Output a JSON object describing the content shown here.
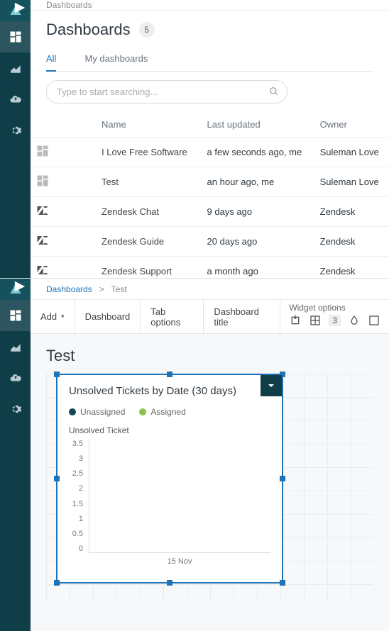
{
  "top": {
    "breadcrumb": "Dashboards",
    "title": "Dashboards",
    "count": "5",
    "tabs": {
      "all": "All",
      "mine": "My dashboards"
    },
    "search_placeholder": "Type to start searching...",
    "columns": {
      "name": "Name",
      "updated": "Last updated",
      "owner": "Owner"
    },
    "rows": [
      {
        "icon": "dash",
        "name": "I Love Free Software",
        "updated": "a few seconds ago, me",
        "owner": "Suleman Love"
      },
      {
        "icon": "dash",
        "name": "Test",
        "updated": "an hour ago, me",
        "owner": "Suleman Love"
      },
      {
        "icon": "zen",
        "name": "Zendesk Chat",
        "updated": "9 days ago",
        "owner": "Zendesk"
      },
      {
        "icon": "zen",
        "name": "Zendesk Guide",
        "updated": "20 days ago",
        "owner": "Zendesk"
      },
      {
        "icon": "zen",
        "name": "Zendesk Support",
        "updated": "a month ago",
        "owner": "Zendesk"
      }
    ]
  },
  "bottom": {
    "breadcrumb": {
      "root": "Dashboards",
      "sep": ">",
      "current": "Test"
    },
    "toolbar": {
      "add": "Add",
      "dashboard": "Dashboard",
      "taboptions": "Tab options",
      "dashtitle": "Dashboard title",
      "widgetopts": "Widget options",
      "decimals": "3"
    },
    "canvas_title": "Test",
    "widget": {
      "title": "Unsolved Tickets by Date (30 days)",
      "legend": {
        "a": "Unassigned",
        "b": "Assigned"
      }
    }
  },
  "chart_data": {
    "type": "line",
    "title": "Unsolved Tickets by Date (30 days)",
    "ylabel": "Unsolved Ticket",
    "xlabel": "",
    "x_ticks": [
      "15 Nov"
    ],
    "y_ticks": [
      "3.5",
      "3",
      "2.5",
      "2",
      "1.5",
      "1",
      "0.5",
      "0"
    ],
    "ylim": [
      0,
      3.5
    ],
    "series": [
      {
        "name": "Unassigned",
        "color": "#0e4a57",
        "values": []
      },
      {
        "name": "Assigned",
        "color": "#8bc34a",
        "values": []
      }
    ]
  }
}
